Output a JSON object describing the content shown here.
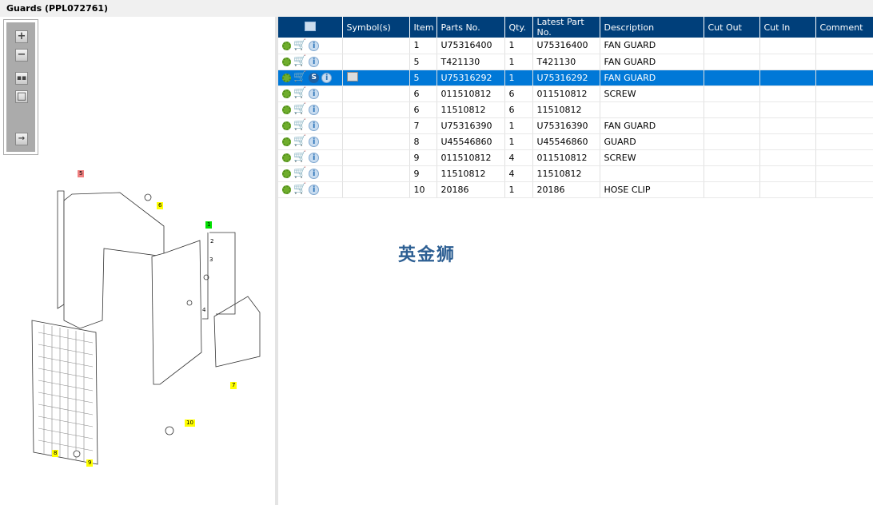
{
  "window_title": "Guards (PPL072761)",
  "toolbar": {
    "icons": [
      "zoom-in-icon",
      "zoom-out-icon",
      "fit-all-icon",
      "fit-window-icon",
      "expand-panel-icon"
    ]
  },
  "diagram": {
    "callouts": {
      "c5": "5",
      "c6": "6",
      "c1": "1",
      "c2": "2",
      "c3": "3",
      "c4": "4",
      "c7": "7",
      "c10": "10",
      "c8": "8",
      "c9": "9"
    }
  },
  "table": {
    "headers": {
      "symbols": "Symbol(s)",
      "item": "Item",
      "parts_no": "Parts No.",
      "qty": "Qty.",
      "latest": "Latest Part No.",
      "desc": "Description",
      "cut_out": "Cut Out",
      "cut_in": "Cut In",
      "comment": "Comment"
    },
    "rows": [
      {
        "item": "1",
        "parts_no": "U75316400",
        "qty": "1",
        "latest": "U75316400",
        "desc": "FAN GUARD"
      },
      {
        "item": "5",
        "parts_no": "T421130",
        "qty": "1",
        "latest": "T421130",
        "desc": "FAN GUARD"
      },
      {
        "item": "5",
        "parts_no": "U75316292",
        "qty": "1",
        "latest": "U75316292",
        "desc": "FAN GUARD",
        "selected": true
      },
      {
        "item": "6",
        "parts_no": "011510812",
        "qty": "6",
        "latest": "011510812",
        "desc": "SCREW"
      },
      {
        "item": "6",
        "parts_no": "11510812",
        "qty": "6",
        "latest": "11510812",
        "desc": ""
      },
      {
        "item": "7",
        "parts_no": "U75316390",
        "qty": "1",
        "latest": "U75316390",
        "desc": "FAN GUARD"
      },
      {
        "item": "8",
        "parts_no": "U45546860",
        "qty": "1",
        "latest": "U45546860",
        "desc": "GUARD"
      },
      {
        "item": "9",
        "parts_no": "011510812",
        "qty": "4",
        "latest": "011510812",
        "desc": "SCREW"
      },
      {
        "item": "9",
        "parts_no": "11510812",
        "qty": "4",
        "latest": "11510812",
        "desc": ""
      },
      {
        "item": "10",
        "parts_no": "20186",
        "qty": "1",
        "latest": "20186",
        "desc": "HOSE CLIP"
      }
    ]
  },
  "watermark": "英金狮",
  "colors": {
    "header": "#003f7a",
    "selected": "#0078d7"
  }
}
